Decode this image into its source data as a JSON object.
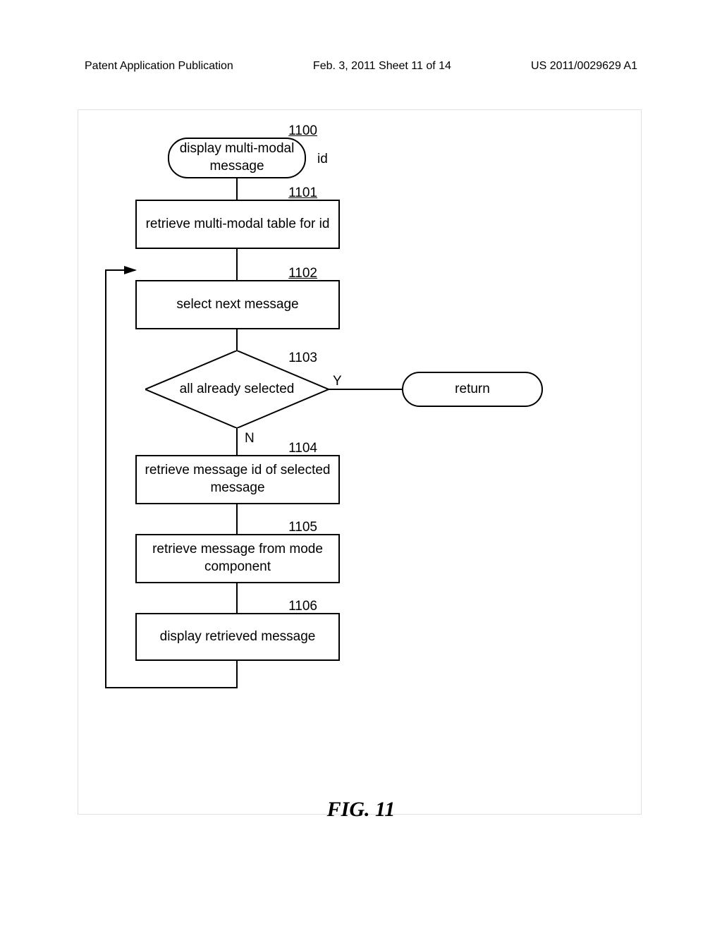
{
  "header": {
    "left": "Patent Application Publication",
    "center": "Feb. 3, 2011   Sheet 11 of 14",
    "right": "US 2011/0029629 A1"
  },
  "steps": {
    "s1100": {
      "num": "1100",
      "text": "display multi-modal message"
    },
    "s1100_side": "id",
    "s1101": {
      "num": "1101",
      "text": "retrieve multi-modal table for id"
    },
    "s1102": {
      "num": "1102",
      "text": "select next message"
    },
    "s1103": {
      "num": "1103",
      "text": "all already selected"
    },
    "s1104": {
      "num": "1104",
      "text": "retrieve message id of selected message"
    },
    "s1105": {
      "num": "1105",
      "text": "retrieve message from mode component"
    },
    "s1106": {
      "num": "1106",
      "text": "display retrieved message"
    },
    "return": "return"
  },
  "yn": {
    "y": "Y",
    "n": "N"
  },
  "figure": "FIG. 11"
}
